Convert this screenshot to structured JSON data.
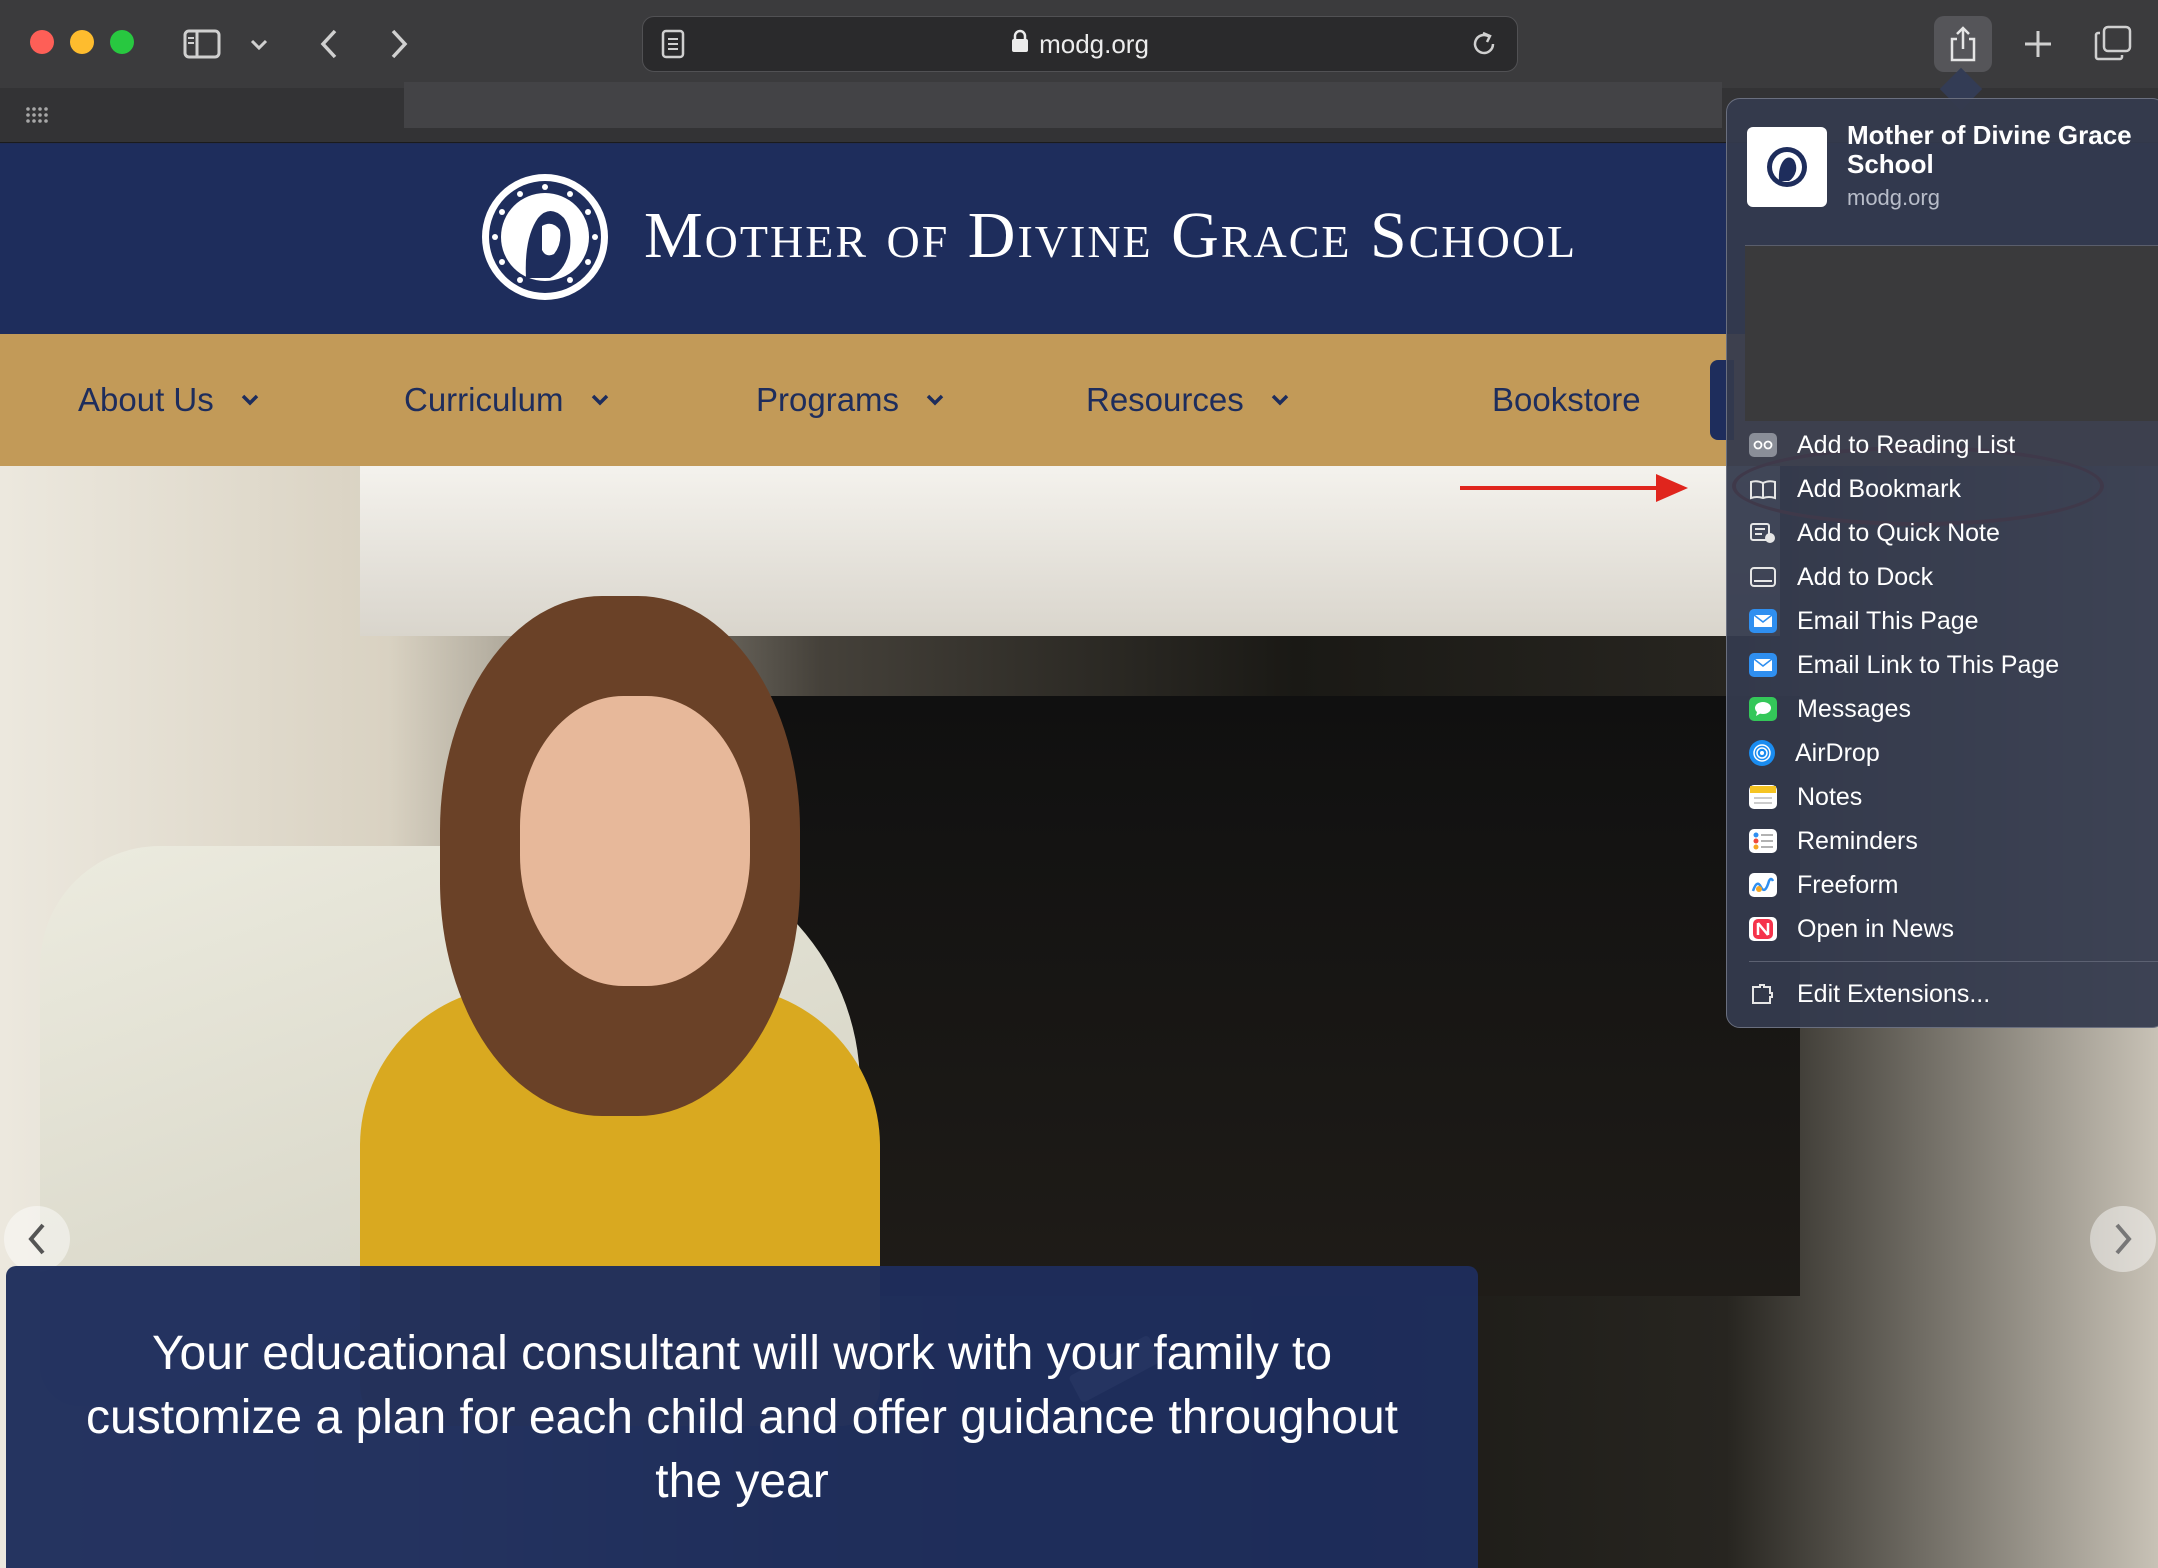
{
  "browser": {
    "url": "modg.org",
    "sidebar_icon": "sidebar-icon",
    "back_icon": "chevron-left-icon",
    "forward_icon": "chevron-right-icon",
    "share_icon": "share-icon",
    "new_tab_icon": "plus-icon",
    "tabs_overview_icon": "tabs-overview-icon"
  },
  "site": {
    "title": "Mother of Divine Grace School",
    "nav": [
      {
        "label": "About Us"
      },
      {
        "label": "Curriculum"
      },
      {
        "label": "Programs"
      },
      {
        "label": "Resources"
      },
      {
        "label": "Bookstore"
      }
    ],
    "hero_caption": "Your educational consultant will work with your family to customize a plan for each child and offer guidance throughout the year",
    "colors": {
      "navy": "#1e2d5c",
      "gold": "#c29a58"
    }
  },
  "share_menu": {
    "page_title": "Mother of Divine Grace School",
    "page_url": "modg.org",
    "items": [
      {
        "label": "Add to Reading List",
        "icon": "reading-list-icon"
      },
      {
        "label": "Add Bookmark",
        "icon": "book-icon"
      },
      {
        "label": "Add to Quick Note",
        "icon": "quick-note-icon"
      },
      {
        "label": "Add to Dock",
        "icon": "dock-icon"
      },
      {
        "label": "Email This Page",
        "icon": "mail-icon"
      },
      {
        "label": "Email Link to This Page",
        "icon": "mail-icon"
      },
      {
        "label": "Messages",
        "icon": "messages-icon"
      },
      {
        "label": "AirDrop",
        "icon": "airdrop-icon"
      },
      {
        "label": "Notes",
        "icon": "notes-icon"
      },
      {
        "label": "Reminders",
        "icon": "reminders-icon"
      },
      {
        "label": "Freeform",
        "icon": "freeform-icon"
      },
      {
        "label": "Open in News",
        "icon": "news-icon"
      }
    ],
    "footer_item": {
      "label": "Edit Extensions...",
      "icon": "extensions-icon"
    }
  },
  "annotation": {
    "highlight_color": "#e0251d",
    "highlighted_item": "Add Bookmark"
  }
}
